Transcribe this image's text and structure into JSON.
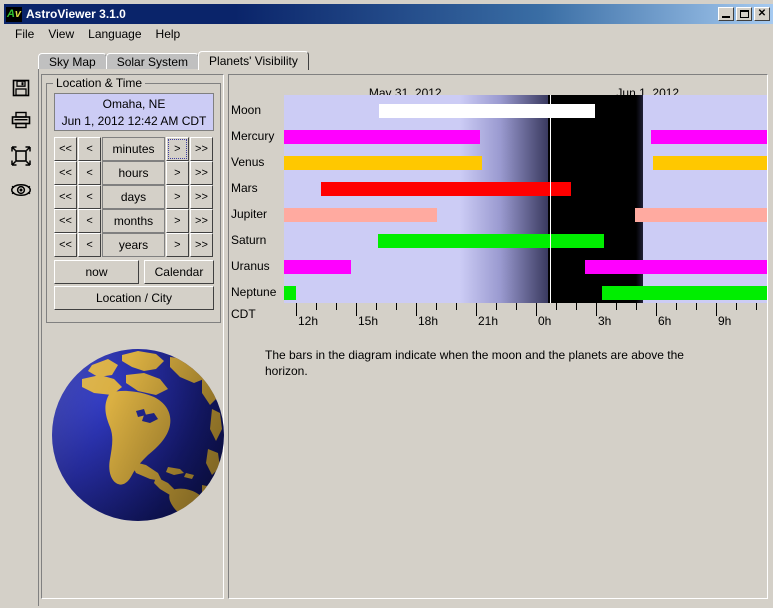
{
  "window": {
    "title": "AstroViewer 3.1.0",
    "icon": "astroviewer-logo-icon",
    "minimize_label": "_",
    "maximize_label": "□",
    "close_label": "✕"
  },
  "menubar": {
    "items": [
      {
        "label": "File"
      },
      {
        "label": "View"
      },
      {
        "label": "Language"
      },
      {
        "label": "Help"
      }
    ]
  },
  "tabs": [
    {
      "label": "Sky Map",
      "selected": false
    },
    {
      "label": "Solar System",
      "selected": false
    },
    {
      "label": "Planets' Visibility",
      "selected": true
    }
  ],
  "toolbar": {
    "items": [
      {
        "name": "save-icon",
        "title": "Save"
      },
      {
        "name": "print-icon",
        "title": "Print"
      },
      {
        "name": "fullscreen-icon",
        "title": "Full screen"
      },
      {
        "name": "eye-icon",
        "title": "View"
      }
    ]
  },
  "location_panel": {
    "group_title": "Location & Time",
    "location": "Omaha, NE",
    "datetime": "Jun 1, 2012 12:42 AM CDT",
    "steppers": [
      {
        "unit": "minutes",
        "back2": "<<",
        "back1": "<",
        "fwd1": ">",
        "fwd2": ">>",
        "focused": true
      },
      {
        "unit": "hours",
        "back2": "<<",
        "back1": "<",
        "fwd1": ">",
        "fwd2": ">>",
        "focused": false
      },
      {
        "unit": "days",
        "back2": "<<",
        "back1": "<",
        "fwd1": ">",
        "fwd2": ">>",
        "focused": false
      },
      {
        "unit": "months",
        "back2": "<<",
        "back1": "<",
        "fwd1": ">",
        "fwd2": ">>",
        "focused": false
      },
      {
        "unit": "years",
        "back2": "<<",
        "back1": "<",
        "fwd1": ">",
        "fwd2": ">>",
        "focused": false
      }
    ],
    "now_label": "now",
    "calendar_label": "Calendar",
    "location_city_label": "Location / City",
    "globe": {
      "name": "earth-globe",
      "ocean_color": "#1d2394",
      "land_color": "#d9ad3c"
    }
  },
  "diagram": {
    "date_headers": [
      {
        "label": "May 31, 2012",
        "center_pct": 25.0
      },
      {
        "label": "Jun 1, 2012",
        "center_pct": 75.0
      }
    ],
    "timezone_label": "CDT",
    "caption": "The bars in the diagram indicate when the moon and the planets are above the horizon.",
    "axis": {
      "start_hour": 11.4,
      "end_hour": 35.65,
      "major_ticks": [
        {
          "label": "12h",
          "hour": 12
        },
        {
          "label": "15h",
          "hour": 15
        },
        {
          "label": "18h",
          "hour": 18
        },
        {
          "label": "21h",
          "hour": 21
        },
        {
          "label": "0h",
          "hour": 24
        },
        {
          "label": "3h",
          "hour": 27
        },
        {
          "label": "6h",
          "hour": 30
        },
        {
          "label": "9h",
          "hour": 33
        }
      ],
      "minor_tick_interval_hours": 1
    },
    "now_marker_hour": 24.7,
    "night": {
      "twilight_start_hour": 20.2,
      "dark_start_hour": 22.2,
      "dark_end_hour": 29.0,
      "twilight_end_hour": 29.35,
      "day_color": "#ccccf5",
      "night_color": "#000000"
    },
    "rows": [
      {
        "body": "Moon",
        "color": "#ffffff",
        "segments": [
          {
            "start_hour": 16.15,
            "end_hour": 26.95
          }
        ]
      },
      {
        "body": "Mercury",
        "color": "#ff00ff",
        "segments": [
          {
            "start_hour": 11.4,
            "end_hour": 21.2
          },
          {
            "start_hour": 29.75,
            "end_hour": 35.65
          }
        ]
      },
      {
        "body": "Venus",
        "color": "#ffc800",
        "segments": [
          {
            "start_hour": 11.4,
            "end_hour": 21.3
          },
          {
            "start_hour": 29.85,
            "end_hour": 35.65
          }
        ]
      },
      {
        "body": "Mars",
        "color": "#ff0000",
        "segments": [
          {
            "start_hour": 13.25,
            "end_hour": 25.75
          }
        ]
      },
      {
        "body": "Jupiter",
        "color": "#ffaaa0",
        "segments": [
          {
            "start_hour": 11.4,
            "end_hour": 19.05
          },
          {
            "start_hour": 28.95,
            "end_hour": 35.65
          }
        ]
      },
      {
        "body": "Saturn",
        "color": "#00ee00",
        "segments": [
          {
            "start_hour": 16.1,
            "end_hour": 27.4
          }
        ]
      },
      {
        "body": "Uranus",
        "color": "#ff00ff",
        "segments": [
          {
            "start_hour": 11.4,
            "end_hour": 14.75
          },
          {
            "start_hour": 26.45,
            "end_hour": 35.65
          }
        ]
      },
      {
        "body": "Neptune",
        "color": "#00ee00",
        "segments": [
          {
            "start_hour": 11.4,
            "end_hour": 12.0
          },
          {
            "start_hour": 27.3,
            "end_hour": 35.65
          }
        ]
      }
    ]
  },
  "chart_data": {
    "type": "bar",
    "title": "Planets' Visibility",
    "subtitle": "The bars in the diagram indicate when the moon and the planets are above the horizon.",
    "xlabel": "CDT",
    "ylabel": "",
    "xlim": [
      11.4,
      35.65
    ],
    "xtick_labels": [
      "12h",
      "15h",
      "18h",
      "21h",
      "0h",
      "3h",
      "6h",
      "9h"
    ],
    "xtick_values": [
      12,
      15,
      18,
      21,
      24,
      27,
      30,
      33
    ],
    "categories": [
      "Moon",
      "Mercury",
      "Venus",
      "Mars",
      "Jupiter",
      "Saturn",
      "Uranus",
      "Neptune"
    ],
    "series": [
      {
        "name": "Moon",
        "color": "#ffffff",
        "intervals": [
          [
            16.15,
            26.95
          ]
        ]
      },
      {
        "name": "Mercury",
        "color": "#ff00ff",
        "intervals": [
          [
            11.4,
            21.2
          ],
          [
            29.75,
            35.65
          ]
        ]
      },
      {
        "name": "Venus",
        "color": "#ffc800",
        "intervals": [
          [
            11.4,
            21.3
          ],
          [
            29.85,
            35.65
          ]
        ]
      },
      {
        "name": "Mars",
        "color": "#ff0000",
        "intervals": [
          [
            13.25,
            25.75
          ]
        ]
      },
      {
        "name": "Jupiter",
        "color": "#ffaaa0",
        "intervals": [
          [
            11.4,
            19.05
          ],
          [
            28.95,
            35.65
          ]
        ]
      },
      {
        "name": "Saturn",
        "color": "#00ee00",
        "intervals": [
          [
            16.1,
            27.4
          ]
        ]
      },
      {
        "name": "Uranus",
        "color": "#ff00ff",
        "intervals": [
          [
            11.4,
            14.75
          ],
          [
            26.45,
            35.65
          ]
        ]
      },
      {
        "name": "Neptune",
        "color": "#00ee00",
        "intervals": [
          [
            11.4,
            12.0
          ],
          [
            27.3,
            35.65
          ]
        ]
      }
    ],
    "annotations": [
      {
        "type": "vline",
        "label": "current time",
        "x": 24.7,
        "color": "#ffffff"
      },
      {
        "type": "band",
        "label": "night",
        "x0": 22.2,
        "x1": 29.0,
        "color": "#000000"
      },
      {
        "type": "date-header",
        "label": "May 31, 2012"
      },
      {
        "type": "date-header",
        "label": "Jun 1, 2012"
      }
    ],
    "grid": false,
    "legend": "none"
  }
}
